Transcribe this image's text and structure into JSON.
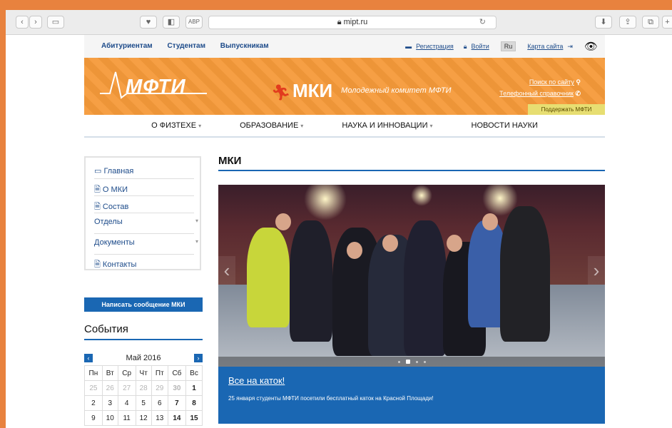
{
  "browser": {
    "url": "mipt.ru",
    "lock_icon": "lock-icon",
    "reload_icon": "reload-icon"
  },
  "topnav": {
    "links": [
      "Абитуриентам",
      "Студентам",
      "Выпускникам"
    ],
    "register": "Регистрация",
    "login": "Войти",
    "lang": "Ru",
    "sitemap": "Карта сайта",
    "eye_icon": "eye-icon"
  },
  "banner": {
    "logo_mipt": "МФТИ",
    "logo_mki": "МКИ",
    "mki_subtitle": "Молодежный комитет МФТИ",
    "search_link": "Поиск по сайту",
    "phone_link": "Телефонный справочник",
    "support": "Поддержать МФТИ"
  },
  "mainmenu": [
    {
      "label": "О ФИЗТЕХЕ",
      "caret": true
    },
    {
      "label": "ОБРАЗОВАНИЕ",
      "caret": true
    },
    {
      "label": "НАУКА И ИННОВАЦИИ",
      "caret": true
    },
    {
      "label": "НОВОСТИ НАУКИ",
      "caret": false
    }
  ],
  "sidebar": {
    "items": [
      {
        "label": "Главная",
        "icon": "home-icon"
      },
      {
        "label": "О МКИ",
        "icon": "doc-icon"
      },
      {
        "label": "Состав",
        "icon": "doc-icon"
      },
      {
        "label": "Отделы",
        "icon": ""
      },
      {
        "label": "Документы",
        "icon": ""
      },
      {
        "label": "Контакты",
        "icon": "doc-icon"
      }
    ],
    "write_button": "Написать сообщение МКИ",
    "events_title": "События"
  },
  "calendar": {
    "title": "Май 2016",
    "weekdays": [
      "Пн",
      "Вт",
      "Ср",
      "Чт",
      "Пт",
      "Сб",
      "Вс"
    ],
    "rows": [
      [
        "25",
        "26",
        "27",
        "28",
        "29",
        "30",
        "1"
      ],
      [
        "2",
        "3",
        "4",
        "5",
        "6",
        "7",
        "8"
      ],
      [
        "9",
        "10",
        "11",
        "12",
        "13",
        "14",
        "15"
      ]
    ]
  },
  "content": {
    "title": "МКИ",
    "slide_title": "Все на каток!",
    "slide_text": "25 января студенты МФТИ посетили бесплатный каток на Красной Площади!",
    "slide_count": 4,
    "active_slide": 2
  },
  "colors": {
    "accent": "#1a67b3",
    "banner": "#f59a3a",
    "link": "#1d4b8a"
  }
}
